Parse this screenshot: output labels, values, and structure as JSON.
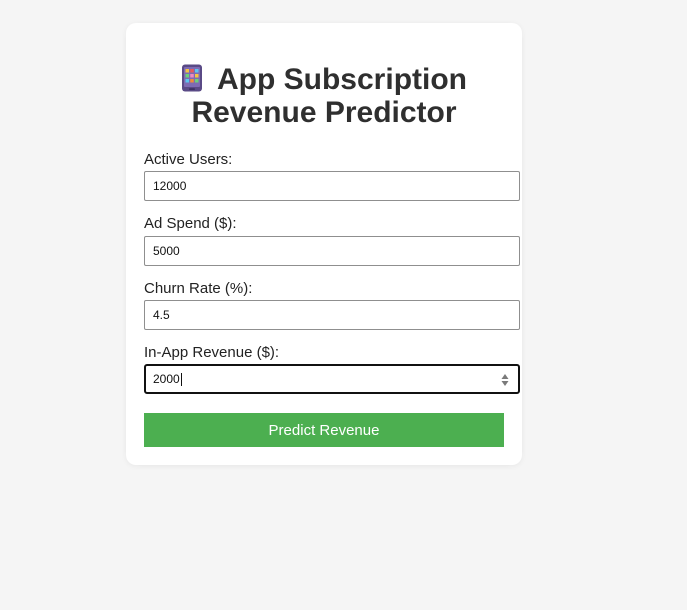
{
  "form": {
    "title": "App Subscription Revenue Predictor",
    "title_icon": "mobile-phone-icon",
    "fields": [
      {
        "label": "Active Users:",
        "value": "12000"
      },
      {
        "label": "Ad Spend ($):",
        "value": "5000"
      },
      {
        "label": "Churn Rate (%):",
        "value": "4.5"
      },
      {
        "label": "In-App Revenue ($):",
        "value": "2000"
      }
    ],
    "submit_label": "Predict Revenue"
  },
  "colors": {
    "page_background": "#f5f5f5",
    "card_background": "#ffffff",
    "button_background": "#4caf50",
    "button_text": "#ffffff"
  }
}
